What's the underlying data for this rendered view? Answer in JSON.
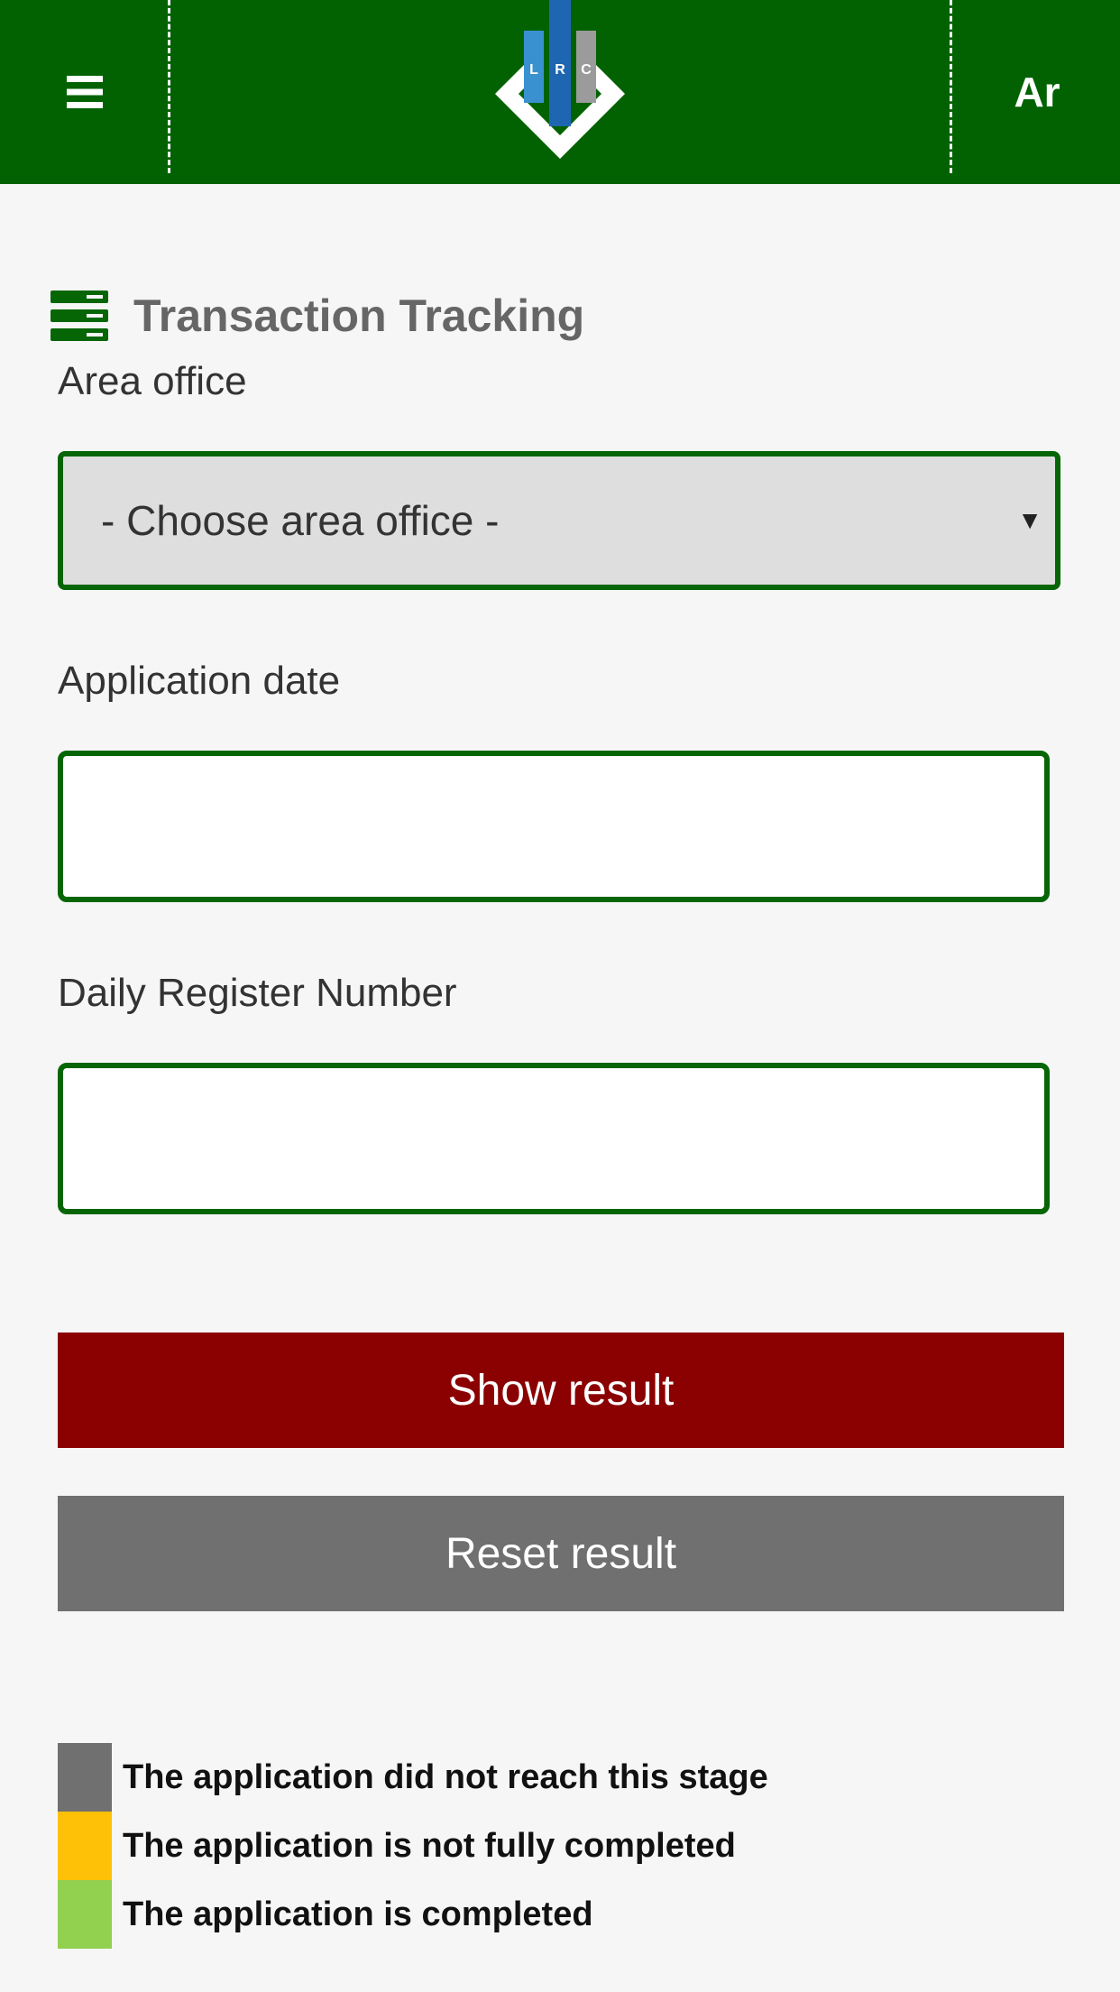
{
  "header": {
    "menu_icon": "hamburger-menu-icon",
    "logo_letters": [
      "L",
      "R",
      "C"
    ],
    "lang_toggle": "Ar",
    "color": "#026202"
  },
  "main": {
    "title_icon": "server-stack-icon",
    "title": "Transaction Tracking",
    "area_office": {
      "label": "Area office",
      "selected": "- Choose area office -"
    },
    "application_date": {
      "label": "Application date",
      "value": ""
    },
    "daily_register": {
      "label": "Daily Register Number",
      "value": ""
    },
    "show_button": "Show result",
    "reset_button": "Reset result"
  },
  "legend": [
    {
      "text": "The application did not reach this stage",
      "color": "#707070"
    },
    {
      "text": "The application is not fully completed",
      "color": "#ffc107"
    },
    {
      "text": "The application is completed",
      "color": "#92d050"
    }
  ],
  "colors": {
    "accent_green": "#066606",
    "show_red": "#8b0000",
    "reset_gray": "#707070"
  }
}
